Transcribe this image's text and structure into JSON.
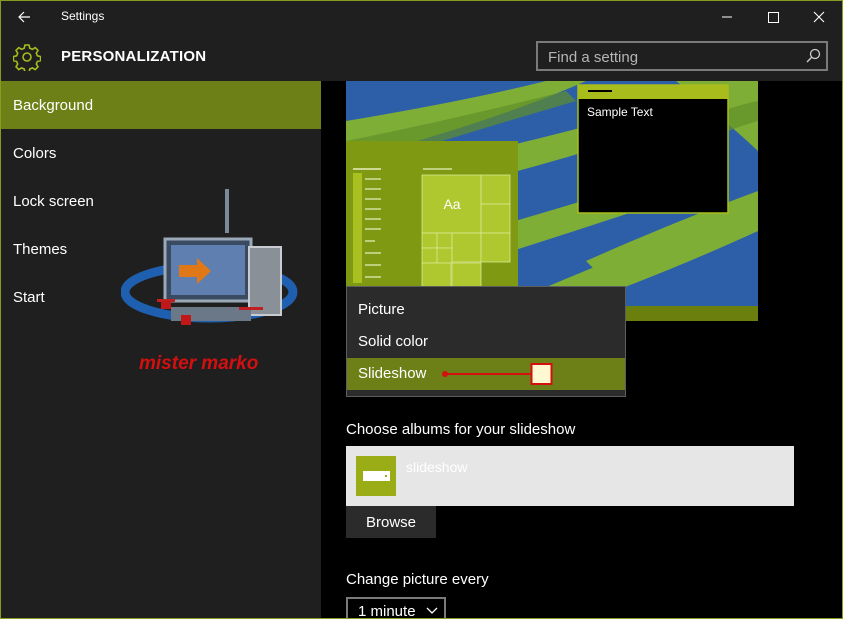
{
  "window": {
    "title": "Settings"
  },
  "header": {
    "title": "PERSONALIZATION",
    "search_placeholder": "Find a setting"
  },
  "sidebar": {
    "items": [
      {
        "label": "Background",
        "active": true
      },
      {
        "label": "Colors"
      },
      {
        "label": "Lock screen"
      },
      {
        "label": "Themes"
      },
      {
        "label": "Start"
      }
    ]
  },
  "watermark": {
    "text": "mister marko"
  },
  "preview": {
    "tile_label": "Aa",
    "sample_text": "Sample Text"
  },
  "background_dropdown": {
    "options": [
      "Picture",
      "Solid color",
      "Slideshow"
    ],
    "selected": "Slideshow"
  },
  "slideshow": {
    "albums_label": "Choose albums for your slideshow",
    "album_name": "slideshow",
    "browse_label": "Browse",
    "interval_label": "Change picture every",
    "interval_value": "1 minute"
  },
  "colors": {
    "accent": "#6d7f17",
    "accent_light": "#9aad16",
    "panel": "#1f1f1f",
    "annotation_red": "#d40f0f"
  },
  "icons": [
    "back-arrow-icon",
    "minimize-icon",
    "maximize-icon",
    "close-icon",
    "gear-icon",
    "search-icon",
    "slideshow-album-icon",
    "chevron-down-icon"
  ]
}
